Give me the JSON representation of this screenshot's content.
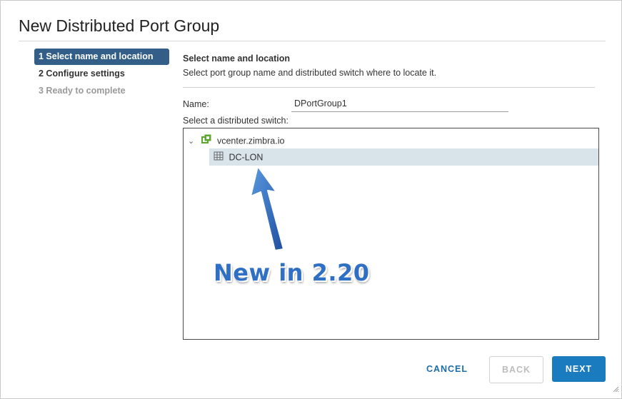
{
  "dialog": {
    "title": "New Distributed Port Group"
  },
  "steps": [
    {
      "label": "1 Select name and location",
      "state": "active"
    },
    {
      "label": "2 Configure settings",
      "state": "enabled"
    },
    {
      "label": "3 Ready to complete",
      "state": "disabled"
    }
  ],
  "section": {
    "title": "Select name and location",
    "description": "Select port group name and distributed switch where to locate it."
  },
  "form": {
    "name_label": "Name:",
    "name_value": "DPortGroup1",
    "switch_label": "Select a distributed switch:"
  },
  "tree": {
    "root": {
      "label": "vcenter.zimbra.io",
      "icon": "vcenter-icon",
      "expanded": true
    },
    "child": {
      "label": "DC-LON",
      "icon": "datacenter-icon",
      "selected": true
    }
  },
  "annotation": {
    "text": "New in 2.20",
    "color": "#2f6fc4"
  },
  "buttons": {
    "cancel": "CANCEL",
    "back": "BACK",
    "next": "NEXT"
  },
  "colors": {
    "active_step": "#325e88",
    "primary_button": "#1a7bbf",
    "selected_row": "#d8e3ea",
    "vcenter_icon": "#5aa829"
  }
}
